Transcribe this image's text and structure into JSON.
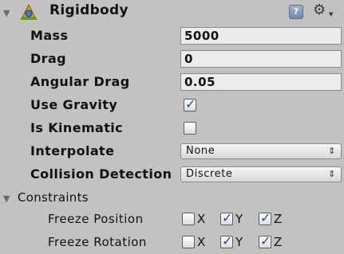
{
  "header": {
    "title": "Rigidbody",
    "help_glyph": "?",
    "fold_icon": "triangle-down",
    "component_icon": "rigidbody-icon",
    "settings_icon": "gear-icon"
  },
  "fields": {
    "mass": {
      "label": "Mass",
      "value": "5000"
    },
    "drag": {
      "label": "Drag",
      "value": "0"
    },
    "angular_drag": {
      "label": "Angular Drag",
      "value": "0.05"
    },
    "use_gravity": {
      "label": "Use Gravity",
      "checked": true
    },
    "is_kinematic": {
      "label": "Is Kinematic",
      "checked": false
    },
    "interpolate": {
      "label": "Interpolate",
      "value": "None"
    },
    "collision_detection": {
      "label": "Collision Detection",
      "value": "Discrete"
    }
  },
  "constraints": {
    "label": "Constraints",
    "freeze_position": {
      "label": "Freeze Position",
      "x": {
        "label": "X",
        "checked": false
      },
      "y": {
        "label": "Y",
        "checked": true
      },
      "z": {
        "label": "Z",
        "checked": true
      }
    },
    "freeze_rotation": {
      "label": "Freeze Rotation",
      "x": {
        "label": "X",
        "checked": false
      },
      "y": {
        "label": "Y",
        "checked": true
      },
      "z": {
        "label": "Z",
        "checked": true
      }
    }
  },
  "glyphs": {
    "fold_arrow": "▼",
    "check": "✓",
    "dropdown_arrow": "⇕",
    "gear": "⚙",
    "caret": "▼"
  },
  "colors": {
    "background": "#c2c2c2",
    "field_bg": "#ececec",
    "checkmark": "#1f4d8a"
  }
}
